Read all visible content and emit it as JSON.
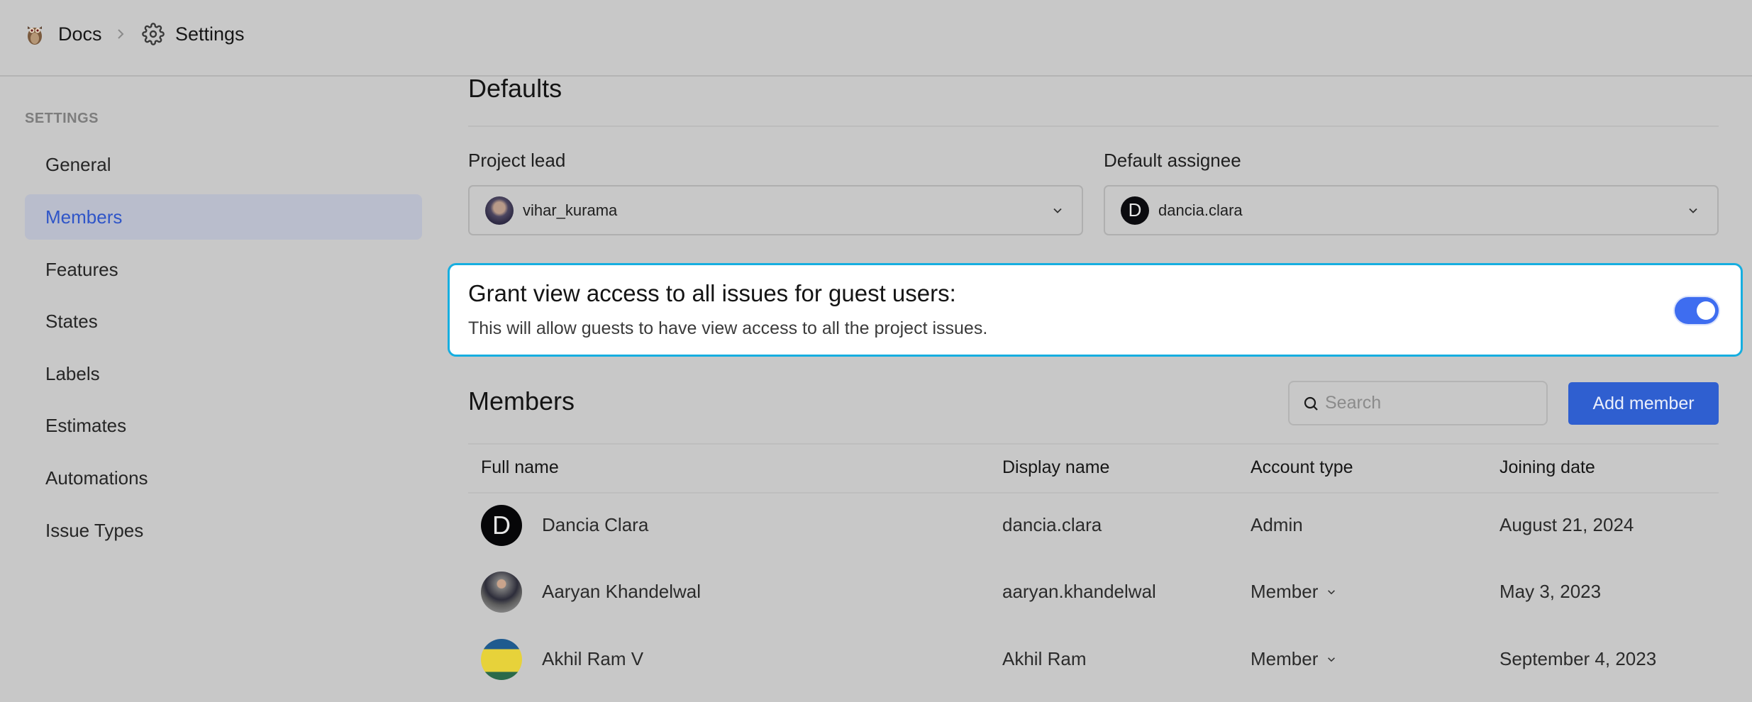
{
  "header": {
    "breadcrumb": [
      {
        "label": "Docs",
        "icon": "owl-logo-icon"
      },
      {
        "label": "Settings",
        "icon": "gear-icon"
      }
    ],
    "separator_icon": "chevron-right-icon"
  },
  "sidebar": {
    "section_title": "SETTINGS",
    "items": [
      {
        "label": "General",
        "active": false
      },
      {
        "label": "Members",
        "active": true
      },
      {
        "label": "Features",
        "active": false
      },
      {
        "label": "States",
        "active": false
      },
      {
        "label": "Labels",
        "active": false
      },
      {
        "label": "Estimates",
        "active": false
      },
      {
        "label": "Automations",
        "active": false
      },
      {
        "label": "Issue Types",
        "active": false
      }
    ]
  },
  "defaults": {
    "title": "Defaults",
    "project_lead": {
      "label": "Project lead",
      "value": "vihar_kurama"
    },
    "default_assignee": {
      "label": "Default assignee",
      "value": "dancia.clara",
      "avatar_letter": "D"
    }
  },
  "guest_access": {
    "title": "Grant view access to all issues for guest users:",
    "description": "This will allow guests to have view access to all the project issues.",
    "enabled": true,
    "toggle_color": "#3e6df0",
    "highlight_color": "#16aee0"
  },
  "members": {
    "title": "Members",
    "search_placeholder": "Search",
    "search_value": "",
    "add_button": "Add member",
    "accent_color": "#2f5fd0",
    "columns": [
      "Full name",
      "Display name",
      "Account type",
      "Joining date"
    ],
    "rows": [
      {
        "full_name": "Dancia Clara",
        "display_name": "dancia.clara",
        "account_type": "Admin",
        "editable": false,
        "joining_date": "August 21, 2024",
        "avatar_letter": "D"
      },
      {
        "full_name": "Aaryan Khandelwal",
        "display_name": "aaryan.khandelwal",
        "account_type": "Member",
        "editable": true,
        "joining_date": "May 3, 2023"
      },
      {
        "full_name": "Akhil Ram V",
        "display_name": "Akhil Ram",
        "account_type": "Member",
        "editable": true,
        "joining_date": "September 4, 2023"
      }
    ]
  }
}
